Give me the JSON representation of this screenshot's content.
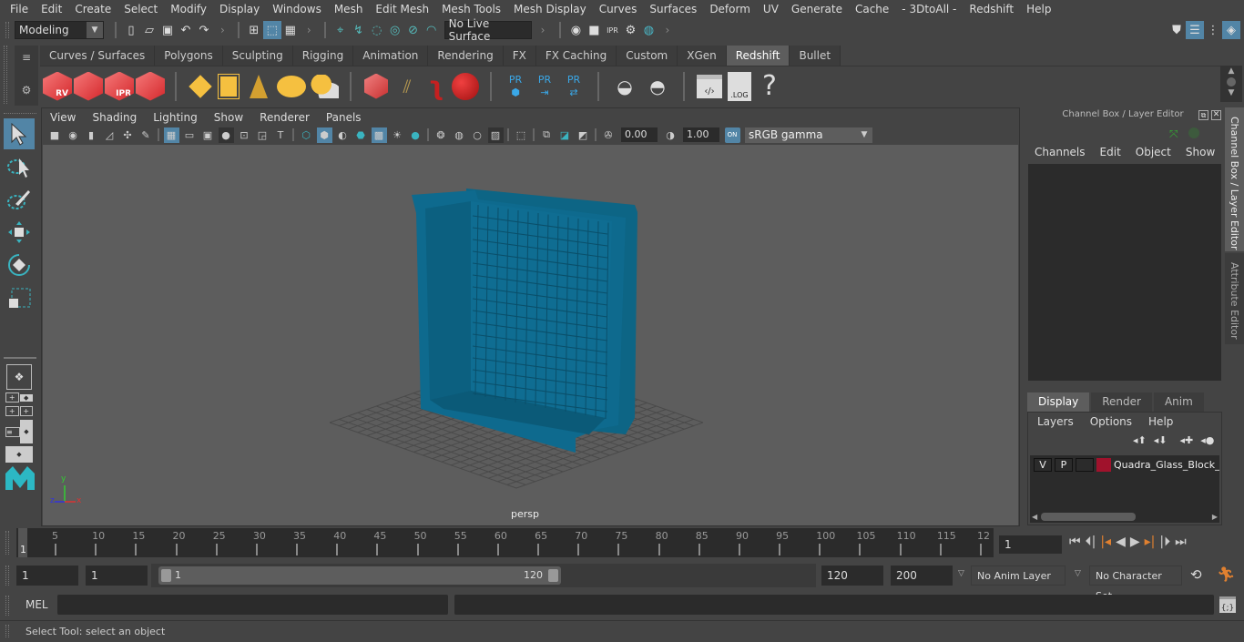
{
  "menubar": [
    "File",
    "Edit",
    "Create",
    "Select",
    "Modify",
    "Display",
    "Windows",
    "Mesh",
    "Edit Mesh",
    "Mesh Tools",
    "Mesh Display",
    "Curves",
    "Surfaces",
    "Deform",
    "UV",
    "Generate",
    "Cache",
    "- 3DtoAll -",
    "Redshift",
    "Help"
  ],
  "statusline": {
    "mode": "Modeling",
    "live_surface": "No Live Surface"
  },
  "shelf": {
    "tabs": [
      "Curves / Surfaces",
      "Polygons",
      "Sculpting",
      "Rigging",
      "Animation",
      "Rendering",
      "FX",
      "FX Caching",
      "Custom",
      "XGen",
      "Redshift",
      "Bullet"
    ],
    "active_tab": "Redshift",
    "icons": [
      "redshift-rv-icon",
      "redshift-batch-render-icon",
      "redshift-ipr-icon",
      "redshift-settings-icon",
      "redshift-light-icon",
      "redshift-area-light-icon",
      "redshift-spot-icon",
      "redshift-dome-icon",
      "redshift-sun-sky-icon",
      "redshift-proxy-icon",
      "redshift-hair-icon",
      "redshift-volume-icon",
      "redshift-sphere-icon",
      "pr-export-icon",
      "pr-import-icon",
      "pr-convert-icon",
      "bake-icon",
      "bake2-icon",
      "shader-editor-icon",
      "log-icon",
      "help-icon"
    ],
    "icon_labels": {
      "rv": "RV",
      "ipr": "IPR",
      "pr": "PR",
      "log": ".LOG",
      "help": "?"
    }
  },
  "viewport": {
    "menu": [
      "View",
      "Shading",
      "Lighting",
      "Show",
      "Renderer",
      "Panels"
    ],
    "exposure": "0.00",
    "gamma": "1.00",
    "color_mgmt_toggle": "ON",
    "color_space": "sRGB gamma",
    "camera_label": "persp",
    "axis": {
      "x": "x",
      "y": "y",
      "z": "z"
    },
    "model_color": "#0e6a8e"
  },
  "channel_box": {
    "title": "Channel Box / Layer Editor",
    "menu": [
      "Channels",
      "Edit",
      "Object",
      "Show"
    ]
  },
  "layer_editor": {
    "tabs": [
      "Display",
      "Render",
      "Anim"
    ],
    "active_tab": "Display",
    "menu": [
      "Layers",
      "Options",
      "Help"
    ],
    "layers": [
      {
        "v": "V",
        "p": "P",
        "color": "#a0122c",
        "name": "Quadra_Glass_Block_B"
      }
    ]
  },
  "side_tabs": [
    "Channel Box / Layer Editor",
    "Attribute Editor"
  ],
  "timeline": {
    "ticks": [
      "5",
      "10",
      "15",
      "20",
      "25",
      "30",
      "35",
      "40",
      "45",
      "50",
      "55",
      "60",
      "65",
      "70",
      "75",
      "80",
      "85",
      "90",
      "95",
      "100",
      "105",
      "110",
      "115",
      "12"
    ],
    "current_frame_marker": "1",
    "current_frame": "1"
  },
  "range": {
    "start": "1",
    "playback_start": "1",
    "slider_start": "1",
    "slider_end": "120",
    "playback_end": "120",
    "end": "200",
    "anim_layer": "No Anim Layer",
    "character_set": "No Character Set"
  },
  "command": {
    "label": "MEL",
    "help": "Select Tool: select an object"
  }
}
